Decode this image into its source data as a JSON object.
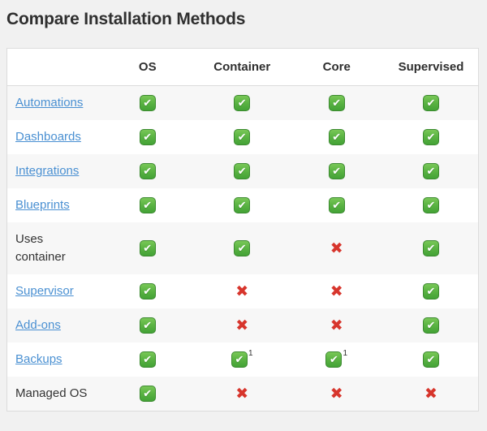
{
  "page": {
    "title": "Compare Installation Methods"
  },
  "colors": {
    "page_background": "#f1f1f1",
    "table_background": "#ffffff",
    "row_stripe": "#f7f7f7",
    "table_border": "#dcdcdc",
    "heading_text": "#2f2f2f",
    "body_text": "#333333",
    "link": "#4a90d2",
    "check_green": "#4caf50",
    "cross_red": "#d7352c"
  },
  "icons": {
    "check": {
      "name": "check-icon",
      "glyph": "✔"
    },
    "cross": {
      "name": "cross-icon",
      "glyph": "✖"
    }
  },
  "table": {
    "columns": [
      "",
      "OS",
      "Container",
      "Core",
      "Supervised"
    ],
    "rows": [
      {
        "label": "Automations",
        "link": true,
        "cells": [
          {
            "icon": "check"
          },
          {
            "icon": "check"
          },
          {
            "icon": "check"
          },
          {
            "icon": "check"
          }
        ]
      },
      {
        "label": "Dashboards",
        "link": true,
        "cells": [
          {
            "icon": "check"
          },
          {
            "icon": "check"
          },
          {
            "icon": "check"
          },
          {
            "icon": "check"
          }
        ]
      },
      {
        "label": "Integrations",
        "link": true,
        "cells": [
          {
            "icon": "check"
          },
          {
            "icon": "check"
          },
          {
            "icon": "check"
          },
          {
            "icon": "check"
          }
        ]
      },
      {
        "label": "Blueprints",
        "link": true,
        "cells": [
          {
            "icon": "check"
          },
          {
            "icon": "check"
          },
          {
            "icon": "check"
          },
          {
            "icon": "check"
          }
        ]
      },
      {
        "label": "Uses container",
        "link": false,
        "cells": [
          {
            "icon": "check"
          },
          {
            "icon": "check"
          },
          {
            "icon": "cross"
          },
          {
            "icon": "check"
          }
        ]
      },
      {
        "label": "Supervisor",
        "link": true,
        "cells": [
          {
            "icon": "check"
          },
          {
            "icon": "cross"
          },
          {
            "icon": "cross"
          },
          {
            "icon": "check"
          }
        ]
      },
      {
        "label": "Add-ons",
        "link": true,
        "cells": [
          {
            "icon": "check"
          },
          {
            "icon": "cross"
          },
          {
            "icon": "cross"
          },
          {
            "icon": "check"
          }
        ]
      },
      {
        "label": "Backups",
        "link": true,
        "cells": [
          {
            "icon": "check"
          },
          {
            "icon": "check",
            "sup": "1"
          },
          {
            "icon": "check",
            "sup": "1"
          },
          {
            "icon": "check"
          }
        ]
      },
      {
        "label": "Managed OS",
        "link": false,
        "cells": [
          {
            "icon": "check"
          },
          {
            "icon": "cross"
          },
          {
            "icon": "cross"
          },
          {
            "icon": "cross"
          }
        ]
      }
    ]
  }
}
